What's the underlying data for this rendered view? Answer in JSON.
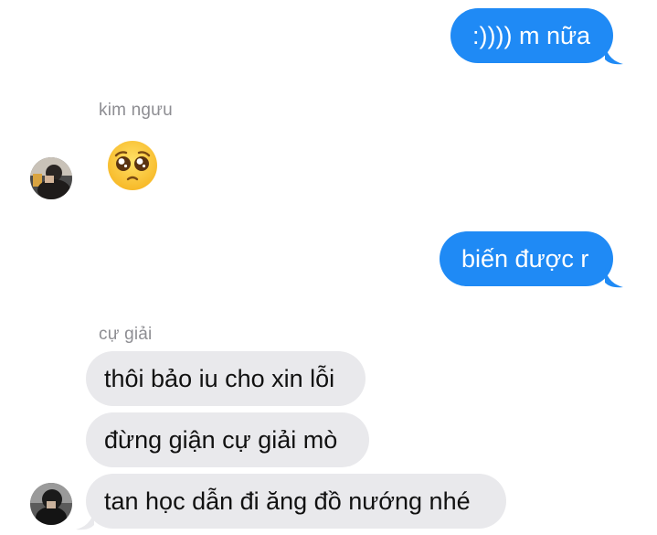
{
  "conversation": {
    "messages": [
      {
        "from": "me",
        "text": ":)))) m nữa"
      },
      {
        "from": "kim ngưu",
        "sender_label": "kim ngưu",
        "emoji": "pleading-face"
      },
      {
        "from": "me",
        "text": "biến được r"
      },
      {
        "from": "cự giải",
        "sender_label": "cự giải",
        "text": "thôi bảo iu cho xin lỗi"
      },
      {
        "from": "cự giải",
        "text": "đừng giận cự giải mò"
      },
      {
        "from": "cự giải",
        "text": "tan học dẫn đi ăng đồ nướng nhé"
      }
    ]
  },
  "colors": {
    "outgoing_bubble": "#1f8af5",
    "incoming_bubble": "#e9e9ec",
    "sender_label": "#8e8e93"
  },
  "icons": [
    "pleading-face-emoji",
    "contact-avatar"
  ]
}
